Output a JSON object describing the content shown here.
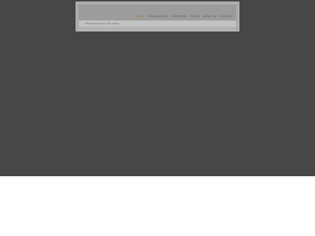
{
  "nav": {
    "items": [
      {
        "label": "Home",
        "active": true
      },
      {
        "label": "Translations",
        "active": false
      },
      {
        "label": "Expertise",
        "active": false
      },
      {
        "label": "Rates",
        "active": false
      },
      {
        "label": "About us",
        "active": false
      },
      {
        "label": "Contact",
        "active": false
      }
    ]
  },
  "breadcrumb": {
    "text": "Bergslund bokstav eller sänkte"
  },
  "colors": {
    "page_background": "#474747",
    "frame": "#a9a9a9",
    "active_nav": "#b0753f",
    "nav_text": "#5a5a5a"
  }
}
